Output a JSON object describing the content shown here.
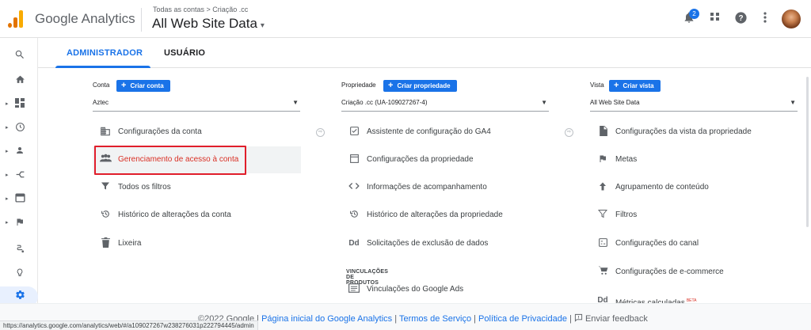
{
  "header": {
    "brand": "Google Analytics",
    "breadcrumb": "Todas as contas > Criação .cc",
    "property": "All Web Site Data",
    "property_caret": "▾",
    "notification_count": "2",
    "icons": [
      "bell-icon",
      "apps-icon",
      "help-icon",
      "more-vert-icon",
      "avatar"
    ]
  },
  "sidebar": {
    "items": [
      "search-icon",
      "home-icon",
      "dashboard-icon",
      "clock-icon",
      "person-icon",
      "acquisition-icon",
      "behavior-icon",
      "flag-icon",
      "route-icon",
      "lightbulb-icon",
      "gear-icon"
    ]
  },
  "tabs": [
    {
      "label": "ADMINISTRADOR"
    },
    {
      "label": "USUÁRIO"
    }
  ],
  "account": {
    "label": "Conta",
    "create": "Criar conta",
    "selected": "Aztec",
    "items": [
      {
        "label": "Configurações da conta",
        "icon": "building-icon"
      },
      {
        "label": "Gerenciamento de acesso à conta",
        "icon": "people-icon"
      },
      {
        "label": "Todos os filtros",
        "icon": "filter-icon"
      },
      {
        "label": "Histórico de alterações da conta",
        "icon": "history-icon"
      },
      {
        "label": "Lixeira",
        "icon": "trash-icon"
      }
    ]
  },
  "property": {
    "label": "Propriedade",
    "create": "Criar propriedade",
    "selected": "Criação .cc (UA-109027267-4)",
    "items": [
      {
        "label": "Assistente de configuração do GA4",
        "icon": "checkbox-icon"
      },
      {
        "label": "Configurações da propriedade",
        "icon": "window-icon"
      },
      {
        "label": "Informações de acompanhamento",
        "icon": "code-icon"
      },
      {
        "label": "Histórico de alterações da propriedade",
        "icon": "history-icon"
      },
      {
        "label": "Solicitações de exclusão de dados",
        "icon": "dd-icon"
      }
    ],
    "section": "VINCULAÇÕES DE PRODUTOS",
    "links": [
      {
        "label": "Vinculações do Google Ads",
        "icon": "ads-icon"
      }
    ]
  },
  "view": {
    "label": "Vista",
    "create": "Criar vista",
    "selected": "All Web Site Data",
    "items": [
      {
        "label": "Configurações da vista da propriedade",
        "icon": "file-icon"
      },
      {
        "label": "Metas",
        "icon": "flag-icon"
      },
      {
        "label": "Agrupamento de conteúdo",
        "icon": "walk-icon"
      },
      {
        "label": "Filtros",
        "icon": "filter-icon"
      },
      {
        "label": "Configurações do canal",
        "icon": "channel-icon"
      },
      {
        "label": "Configurações de e-commerce",
        "icon": "cart-icon"
      },
      {
        "label": "Métricas calculadas",
        "icon": "dd-icon",
        "badge": "BETA"
      }
    ]
  },
  "footer": {
    "copyright": "©2022 Google | ",
    "link1": "Página inicial do Google Analytics",
    "sep1": " | ",
    "link2": "Termos de Serviço",
    "sep2": " | ",
    "link3": "Política de Privacidade",
    "sep3": " | ",
    "feedback": "Enviar feedback"
  },
  "status_url": "https://analytics.google.com/analytics/web/#/a109027267w238276031p222794445/admin",
  "colors": {
    "accent": "#1a73e8",
    "highlight": "#e01e2b"
  }
}
